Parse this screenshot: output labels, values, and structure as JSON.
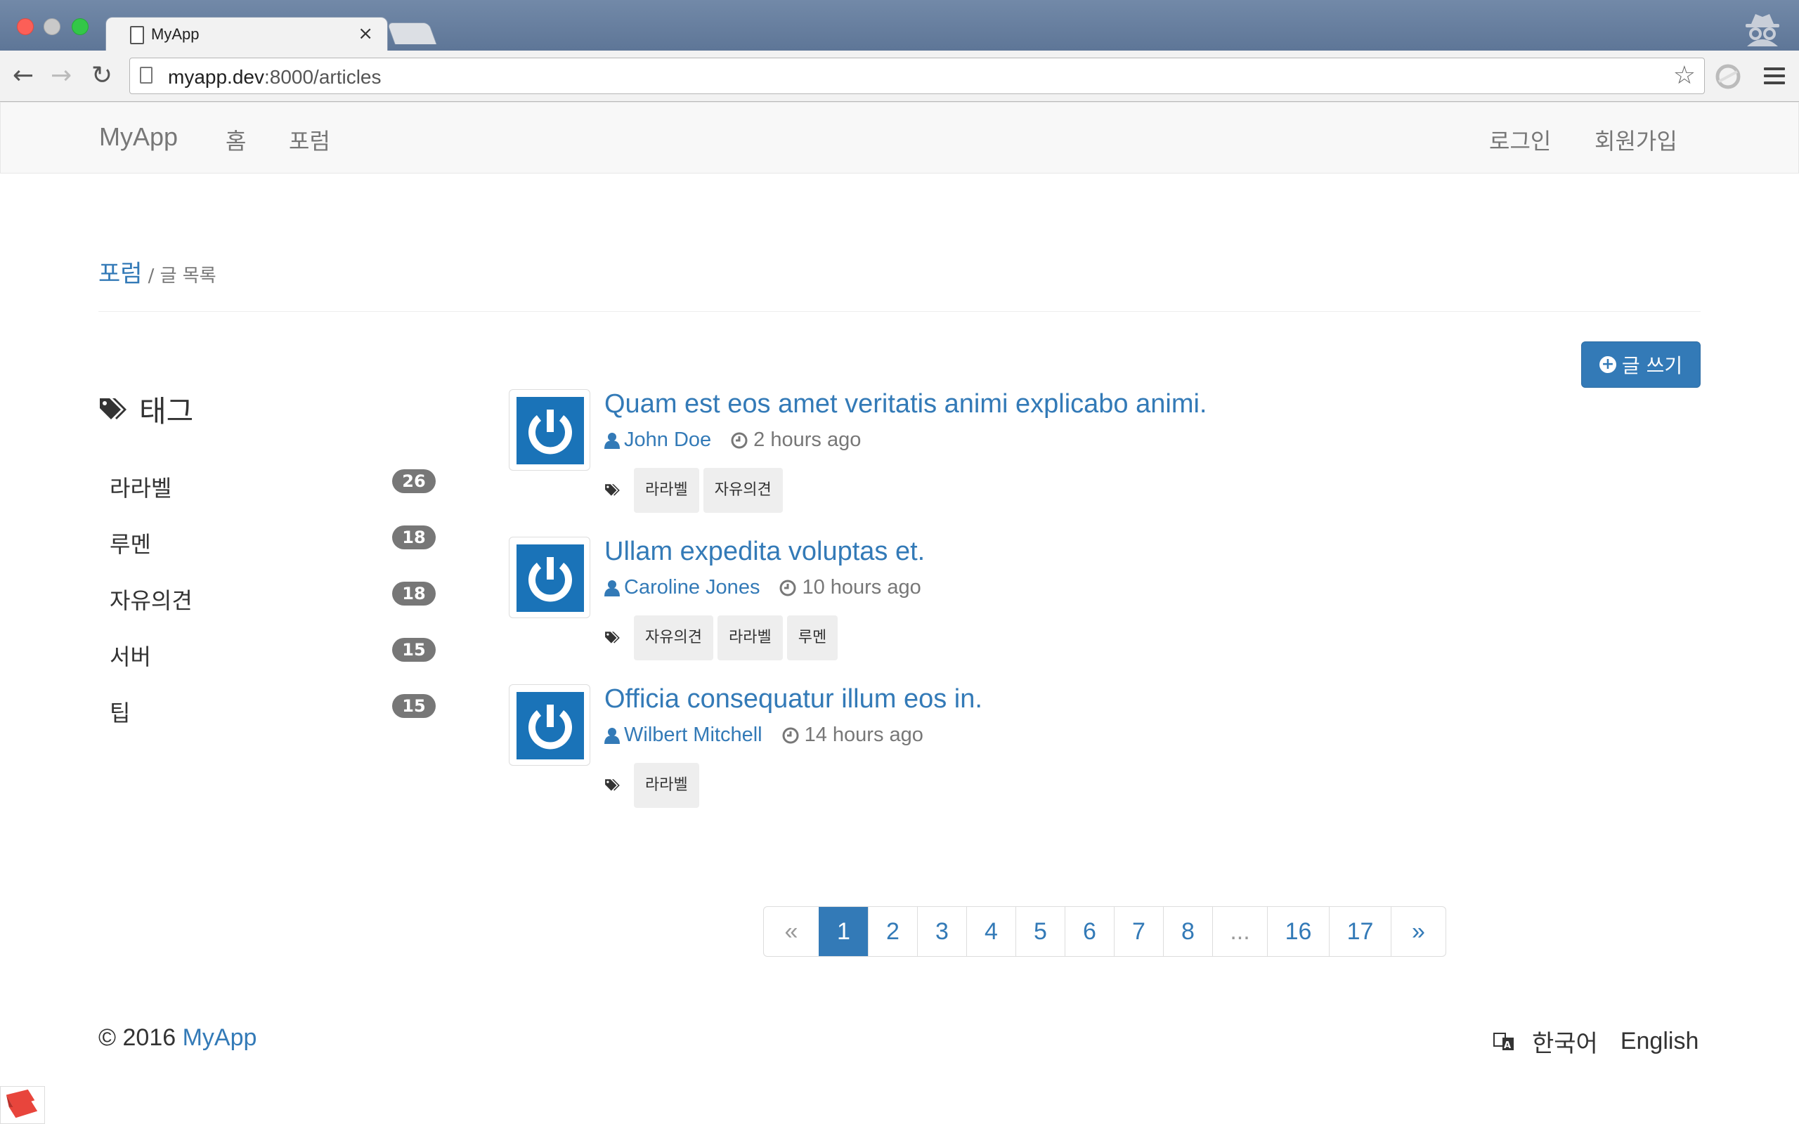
{
  "browser": {
    "tab_title": "MyApp",
    "tab_close": "×",
    "url_host": "myapp.dev",
    "url_rest": ":8000/articles",
    "nav_back": "←",
    "nav_forward": "→",
    "nav_reload": "↻",
    "bookmark_star": "☆"
  },
  "navbar": {
    "brand": "MyApp",
    "links": {
      "home": "홈",
      "forum": "포럼"
    },
    "auth": {
      "login": "로그인",
      "signup": "회원가입"
    }
  },
  "header": {
    "title": "포럼",
    "subtitle": "/ 글 목록",
    "write_button": "글 쓰기",
    "write_icon": "+"
  },
  "sidebar": {
    "heading": "태그",
    "tags": [
      {
        "name": "라라벨",
        "count": "26"
      },
      {
        "name": "루멘",
        "count": "18"
      },
      {
        "name": "자유의견",
        "count": "18"
      },
      {
        "name": "서버",
        "count": "15"
      },
      {
        "name": "팁",
        "count": "15"
      }
    ]
  },
  "articles": [
    {
      "title": "Quam est eos amet veritatis animi explicabo animi.",
      "author": "John Doe",
      "time": "2 hours ago",
      "tags": [
        "라라벨",
        "자유의견"
      ]
    },
    {
      "title": "Ullam expedita voluptas et.",
      "author": "Caroline Jones",
      "time": "10 hours ago",
      "tags": [
        "자유의견",
        "라라벨",
        "루멘"
      ]
    },
    {
      "title": "Officia consequatur illum eos in.",
      "author": "Wilbert Mitchell",
      "time": "14 hours ago",
      "tags": [
        "라라벨"
      ]
    }
  ],
  "pagination": {
    "prev": "«",
    "pages": [
      "1",
      "2",
      "3",
      "4",
      "5",
      "6",
      "7",
      "8",
      "...",
      "16",
      "17"
    ],
    "next": "»",
    "current": "1"
  },
  "footer": {
    "copyright": "© 2016",
    "brand": "MyApp",
    "lang_korean": "한국어",
    "lang_english": "English"
  },
  "colors": {
    "primary": "#337ab7",
    "avatar": "#1a73b8",
    "badge": "#777777"
  }
}
